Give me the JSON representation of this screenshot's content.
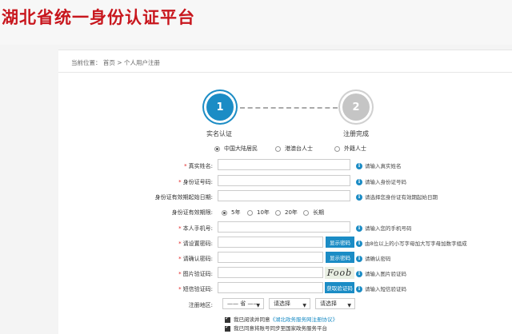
{
  "header": {
    "logo_text": "湖北省统一身份认证平台"
  },
  "breadcrumb": {
    "prefix": "当前位置：",
    "home": "首页",
    "separator": ">",
    "current": "个人用户注册"
  },
  "steps": [
    {
      "number": "1",
      "label": "实名认证",
      "active": true
    },
    {
      "number": "2",
      "label": "注册完成",
      "active": false
    }
  ],
  "identity_types": [
    {
      "label": "中国大陆居民",
      "selected": true
    },
    {
      "label": "港澳台人士",
      "selected": false
    },
    {
      "label": "外籍人士",
      "selected": false
    }
  ],
  "form": {
    "real_name": {
      "label": "真实姓名:",
      "tip": "请输入真实姓名",
      "value": ""
    },
    "id_number": {
      "label": "身份证号码:",
      "tip": "请输入身份证号码",
      "value": ""
    },
    "id_start": {
      "label": "身份证有效期起始日期:",
      "tip": "请选择您身份证有效期起始日期",
      "value": ""
    },
    "validity": {
      "label": "身份证有效期限:",
      "options": [
        {
          "label": "5年",
          "selected": true
        },
        {
          "label": "10年",
          "selected": false
        },
        {
          "label": "20年",
          "selected": false
        },
        {
          "label": "长期",
          "selected": false
        }
      ]
    },
    "phone": {
      "label": "本人手机号:",
      "tip": "请输入您的手机号码",
      "value": ""
    },
    "password": {
      "label": "请设置密码:",
      "tip": "由8位以上的小写字母加大写字母加数字组成",
      "button": "显示密码",
      "value": ""
    },
    "password_confirm": {
      "label": "请确认密码:",
      "tip": "请确认密码",
      "button": "显示密码",
      "value": ""
    },
    "image_code": {
      "label": "图片验证码:",
      "tip": "请输入图片验证码",
      "captcha_text": "Foob",
      "value": ""
    },
    "sms_code": {
      "label": "短信验证码:",
      "tip": "请输入短信验证码",
      "button": "获取验证码",
      "value": ""
    },
    "region": {
      "label": "注册地区:",
      "selects": [
        "—— 省 ——",
        "请选择",
        "请选择"
      ]
    }
  },
  "agreements": {
    "agree_prefix": "我已阅读并同意",
    "agree_link": "《湖北政务服务网注册协议》",
    "sync": "我已同意将账号同步至国家政务服务平台"
  },
  "colors": {
    "brand_red": "#c8161d",
    "accent_blue": "#1b8cc5",
    "required_red": "#e02020"
  }
}
